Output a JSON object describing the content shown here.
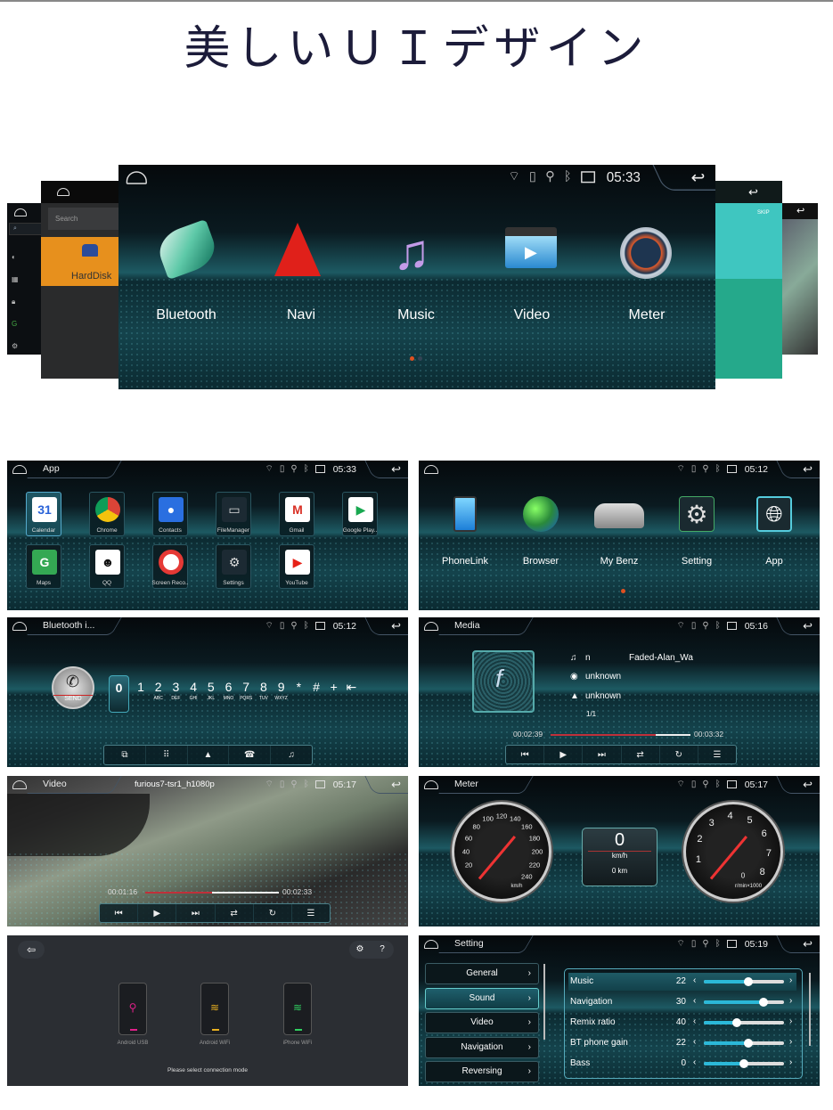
{
  "page_title": "美しいＵＩデザイン",
  "colors": {
    "accent": "#2bb8d8",
    "progress": "#c0303a",
    "title": "#1c1c3a"
  },
  "hero": {
    "time": "05:33",
    "status_icons": [
      "wifi-icon",
      "sd-card-icon",
      "usb-icon",
      "bluetooth-icon",
      "screen-icon"
    ],
    "items": [
      {
        "label": "Bluetooth",
        "icon": "bluetooth-app-icon"
      },
      {
        "label": "Navi",
        "icon": "navi-arrow-icon"
      },
      {
        "label": "Music",
        "icon": "music-note-icon"
      },
      {
        "label": "Video",
        "icon": "clapperboard-icon"
      },
      {
        "label": "Meter",
        "icon": "speedometer-icon"
      }
    ],
    "active_page": 1,
    "page_count": 2,
    "back_left": {
      "search_placeholder": "Search",
      "harddisk_label": "HardDisk"
    },
    "back_right": {
      "skip_label": "SKIP"
    }
  },
  "screens": {
    "app": {
      "title": "App",
      "time": "05:33",
      "apps": [
        {
          "label": "Calendar",
          "icon": "calendar-icon",
          "glyph": "31",
          "bg": "#ffffff",
          "fg": "#2a63d8",
          "selected": true
        },
        {
          "label": "Chrome",
          "icon": "chrome-icon",
          "glyph": "",
          "bg": "#ffffff",
          "fg": "#000"
        },
        {
          "label": "Contacts",
          "icon": "contacts-icon",
          "glyph": "●",
          "bg": "#2a6fe0",
          "fg": "#fff"
        },
        {
          "label": "FileManager",
          "icon": "folder-icon",
          "glyph": "▭",
          "bg": "#1c2a33",
          "fg": "#ddd"
        },
        {
          "label": "Gmail",
          "icon": "gmail-icon",
          "glyph": "M",
          "bg": "#ffffff",
          "fg": "#d93025"
        },
        {
          "label": "Google Play..",
          "icon": "google-play-icon",
          "glyph": "▶",
          "bg": "#ffffff",
          "fg": "#18a850"
        },
        {
          "label": "Maps",
          "icon": "maps-icon",
          "glyph": "G",
          "bg": "#34a853",
          "fg": "#fff"
        },
        {
          "label": "QQ",
          "icon": "qq-penguin-icon",
          "glyph": "☻",
          "bg": "#ffffff",
          "fg": "#111"
        },
        {
          "label": "Screen Reco..",
          "icon": "screen-record-icon",
          "glyph": "●",
          "bg": "#e53935",
          "fg": "#fff"
        },
        {
          "label": "Settings",
          "icon": "gear-icon",
          "glyph": "⚙",
          "bg": "#1c2a33",
          "fg": "#ddd"
        },
        {
          "label": "YouTube",
          "icon": "youtube-icon",
          "glyph": "▶",
          "bg": "#ffffff",
          "fg": "#e62117"
        }
      ]
    },
    "home2": {
      "time": "05:12",
      "items": [
        {
          "label": "PhoneLink",
          "icon": "phonelink-icon"
        },
        {
          "label": "Browser",
          "icon": "globe-icon"
        },
        {
          "label": "My Benz",
          "icon": "car-icon"
        },
        {
          "label": "Setting",
          "icon": "gear-icon"
        },
        {
          "label": "App",
          "icon": "app-globe-icon"
        }
      ],
      "active_page": 1,
      "page_count": 1
    },
    "bluetooth": {
      "title": "Bluetooth i...",
      "time": "05:12",
      "send_label": "SEND",
      "display_digit": "0",
      "keys": [
        {
          "k": "1",
          "s": ""
        },
        {
          "k": "2",
          "s": "ABC"
        },
        {
          "k": "3",
          "s": "DEF"
        },
        {
          "k": "4",
          "s": "GHI"
        },
        {
          "k": "5",
          "s": "JKL"
        },
        {
          "k": "6",
          "s": "MNO"
        },
        {
          "k": "7",
          "s": "PQRS"
        },
        {
          "k": "8",
          "s": "TUV"
        },
        {
          "k": "9",
          "s": "WXYZ"
        },
        {
          "k": "*",
          "s": ""
        },
        {
          "k": "#",
          "s": ""
        },
        {
          "k": "+",
          "s": ""
        },
        {
          "k": "⇤",
          "s": ""
        }
      ],
      "tabs": [
        {
          "icon": "contacts-sync-icon",
          "g": "⧉"
        },
        {
          "icon": "dialpad-icon",
          "g": "⠿"
        },
        {
          "icon": "person-icon",
          "g": "▲"
        },
        {
          "icon": "call-log-icon",
          "g": "☎"
        },
        {
          "icon": "bt-music-icon",
          "g": "♫"
        }
      ]
    },
    "media": {
      "title": "Media",
      "time": "05:16",
      "track_prefix": "n",
      "track": "Faded-Alan_Wa",
      "album": "unknown",
      "artist": "unknown",
      "index": "1/1",
      "elapsed": "00:02:39",
      "total": "00:03:32",
      "progress": 0.75
    },
    "video": {
      "title": "Video",
      "filename": "furious7-tsr1_h1080p",
      "time": "05:17",
      "elapsed": "00:01:16",
      "total": "00:02:33",
      "progress": 0.5
    },
    "controls": [
      {
        "icon": "previous-icon",
        "g": "⏮"
      },
      {
        "icon": "play-icon",
        "g": "▶"
      },
      {
        "icon": "next-icon",
        "g": "⏭"
      },
      {
        "icon": "shuffle-icon",
        "g": "⇄"
      },
      {
        "icon": "repeat-icon",
        "g": "↻"
      },
      {
        "icon": "playlist-icon",
        "g": "☰"
      }
    ],
    "meter": {
      "title": "Meter",
      "time": "05:17",
      "speed": "0",
      "speed_unit": "km/h",
      "distance": "0 km",
      "speedo_ticks": [
        "20",
        "40",
        "60",
        "80",
        "100",
        "120",
        "140",
        "160",
        "180",
        "200",
        "220",
        "240"
      ],
      "speedo_unit": "km/h",
      "tacho_ticks": [
        "1",
        "2",
        "3",
        "4",
        "5",
        "6",
        "7",
        "8"
      ],
      "tacho_value": "0",
      "tacho_unit": "r/min×1000"
    },
    "phonelink": {
      "options": [
        {
          "label": "Android USB",
          "icon": "usb-icon",
          "color": "#e0208a"
        },
        {
          "label": "Android WiFi",
          "icon": "wifi-icon",
          "color": "#e8b020"
        },
        {
          "label": "iPhone WiFi",
          "icon": "wifi-icon",
          "color": "#30d060"
        }
      ],
      "prompt": "Please select connection mode"
    },
    "setting": {
      "title": "Setting",
      "time": "05:19",
      "menu": [
        "General",
        "Sound",
        "Video",
        "Navigation",
        "Reversing"
      ],
      "active_menu": 1,
      "sliders": [
        {
          "label": "Music",
          "value": "22",
          "level": 0.55
        },
        {
          "label": "Navigation",
          "value": "30",
          "level": 0.74
        },
        {
          "label": "Remix ratio",
          "value": "40",
          "level": 0.41
        },
        {
          "label": "BT phone gain",
          "value": "22",
          "level": 0.55
        },
        {
          "label": "Bass",
          "value": "0",
          "level": 0.5
        }
      ]
    }
  }
}
